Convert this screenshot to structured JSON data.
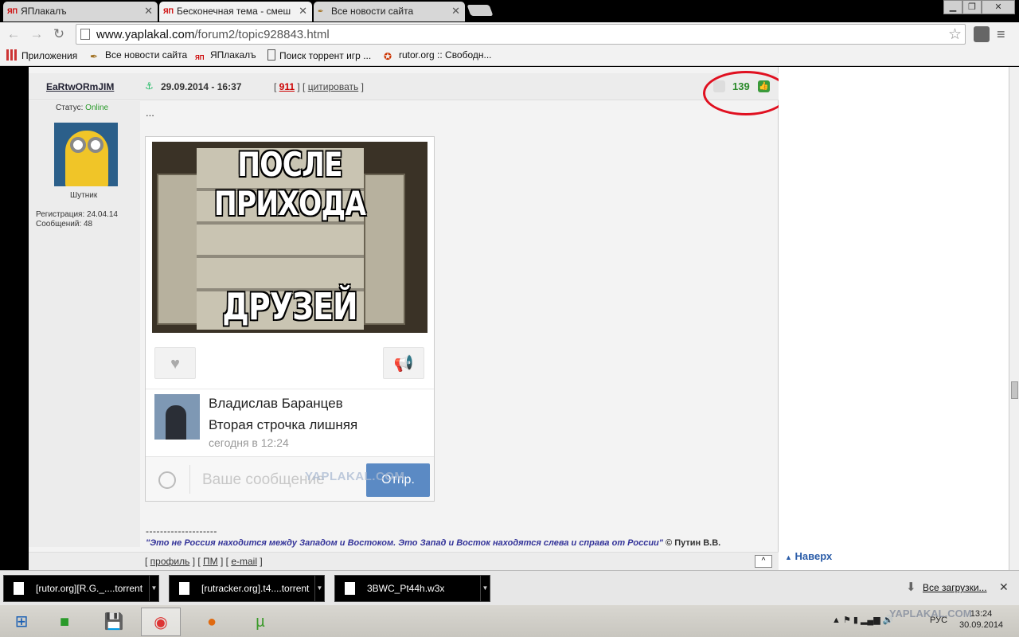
{
  "browser": {
    "tabs": [
      {
        "label": "ЯПлакалъ",
        "favicon": "ЯП"
      },
      {
        "label": "Бесконечная тема - смеш",
        "favicon": "ЯП"
      },
      {
        "label": "Все новости сайта",
        "favicon": "feather"
      }
    ],
    "url_domain": "www.yaplakal.com",
    "url_path": "/forum2/topic928843.html",
    "bookmarks": [
      {
        "label": "Приложения",
        "icon": "apps-grid-icon"
      },
      {
        "label": "Все новости сайта",
        "icon": "feather-icon"
      },
      {
        "label": "ЯПлакалъ",
        "icon": "yp-icon"
      },
      {
        "label": "Поиск торрент игр ...",
        "icon": "page-icon"
      },
      {
        "label": "rutor.org :: Свободн...",
        "icon": "rutor-icon"
      }
    ]
  },
  "post": {
    "username": "EaRtwORmJIM",
    "date": "29.09.2014 - 16:37",
    "number": "911",
    "cite_label": "цитировать",
    "rating": "139",
    "status_label": "Статус:",
    "status_value": "Online",
    "rank": "Шутник",
    "registration": "Регистрация: 24.04.14",
    "messages": "Сообщений: 48",
    "text": "...",
    "meme_top": "ПОСЛЕ ПРИХОДА",
    "meme_bottom": "ДРУЗЕЙ",
    "vk": {
      "name": "Владислав Баранцев",
      "message": "Вторая строчка лишняя",
      "time": "сегодня в 12:24",
      "input_placeholder": "Ваше сообщение",
      "send_label": "Отпр.",
      "watermark": "YAPLAKAL.COM"
    },
    "separator": "--------------------",
    "signature_quote": "\"Это не Россия находится между Западом и Востоком. Это Запад и Восток находятся слева и справа от России\"",
    "signature_author": "© Путин В.В.",
    "footer_profile": "профиль",
    "footer_pm": "ПМ",
    "footer_email": "e-mail",
    "up_button": "^"
  },
  "sidebar": {
    "naverh": "Наверх"
  },
  "downloads": {
    "items": [
      {
        "label": "[rutor.org][R.G._....torrent"
      },
      {
        "label": "[rutracker.org].t4....torrent"
      },
      {
        "label": "3BWC_Pt44h.w3x"
      }
    ],
    "show_all": "Все загрузки..."
  },
  "taskbar": {
    "language": "РУС",
    "time": "13:24",
    "date": "30.09.2014",
    "watermark": "YAPLAKAL.COM"
  },
  "colors": {
    "rating_green": "#2a8a2a",
    "annotation_red": "#e01020",
    "vk_blue": "#5b8ac4"
  }
}
